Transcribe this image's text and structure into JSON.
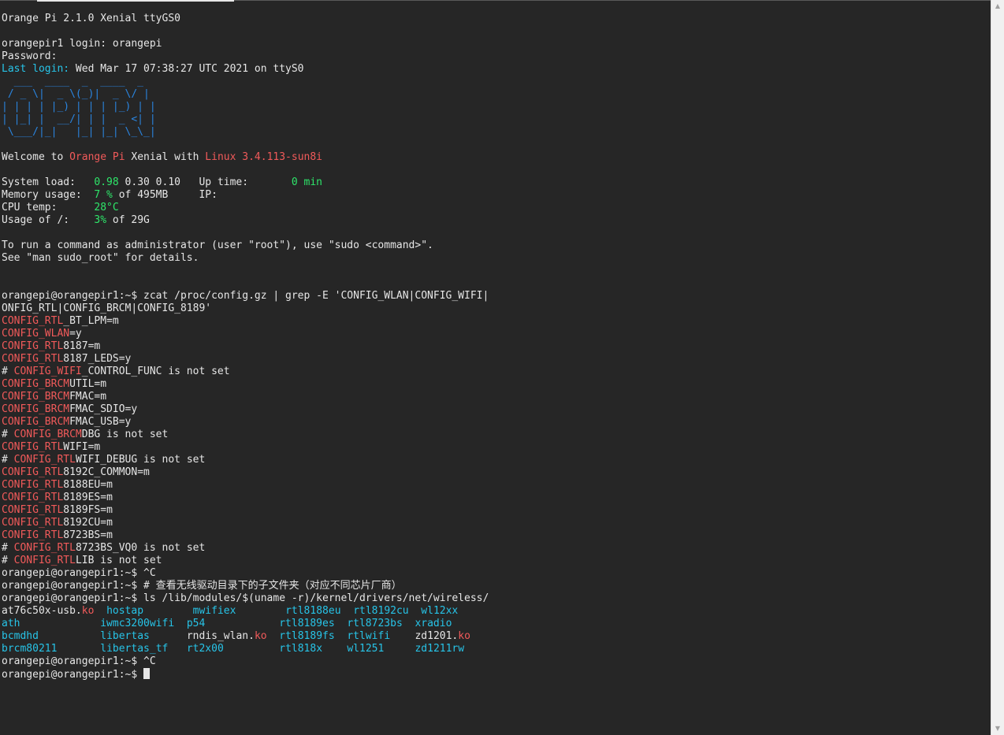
{
  "terminal": {
    "lines": [
      [
        {
          "t": "Orange Pi 2.1.0 Xenial ttyGS0",
          "c": "w"
        }
      ],
      [],
      [
        {
          "t": "orangepir1 login: orangepi",
          "c": "w"
        }
      ],
      [
        {
          "t": "Password:",
          "c": "w"
        }
      ],
      [
        {
          "t": "Last login: ",
          "c": "c"
        },
        {
          "t": "Wed Mar 17 07:38:27 UTC 2021 on ttyS0",
          "c": "w"
        }
      ],
      [
        {
          "t": "  ___  ____  _  ____  _ ",
          "c": "b"
        }
      ],
      [
        {
          "t": " / _ \\|  _ \\(_)|  _ \\/ |",
          "c": "b"
        }
      ],
      [
        {
          "t": "| | | | |_) | | | |_) | |",
          "c": "b"
        }
      ],
      [
        {
          "t": "| |_| |  __/| | |  _ <| |",
          "c": "b"
        }
      ],
      [
        {
          "t": " \\___/|_|   |_| |_| \\_\\_|",
          "c": "b"
        }
      ],
      [],
      [
        {
          "t": "Welcome to ",
          "c": "w"
        },
        {
          "t": "Orange Pi",
          "c": "r"
        },
        {
          "t": " Xenial with ",
          "c": "w"
        },
        {
          "t": "Linux 3.4.113-sun8i",
          "c": "r"
        }
      ],
      [],
      [
        {
          "t": "System load:   ",
          "c": "w"
        },
        {
          "t": "0.98",
          "c": "g"
        },
        {
          "t": " 0.30 0.10   Up time:       ",
          "c": "w"
        },
        {
          "t": "0 min",
          "c": "g"
        }
      ],
      [
        {
          "t": "Memory usage:  ",
          "c": "w"
        },
        {
          "t": "7 %",
          "c": "g"
        },
        {
          "t": " of 495MB     IP:",
          "c": "w"
        }
      ],
      [
        {
          "t": "CPU temp:      ",
          "c": "w"
        },
        {
          "t": "28°C",
          "c": "g"
        }
      ],
      [
        {
          "t": "Usage of /:    ",
          "c": "w"
        },
        {
          "t": "3%",
          "c": "g"
        },
        {
          "t": " of 29G",
          "c": "w"
        }
      ],
      [],
      [
        {
          "t": "To run a command as administrator (user \"root\"), use \"sudo <command>\".",
          "c": "w"
        }
      ],
      [
        {
          "t": "See \"man sudo_root\" for details.",
          "c": "w"
        }
      ],
      [],
      [],
      [
        {
          "t": "orangepi@orangepir1:~$ zcat /proc/config.gz | grep -E 'CONFIG_WLAN|CONFIG_WIFI|",
          "c": "w"
        }
      ],
      [
        {
          "t": "ONFIG_RTL|CONFIG_BRCM|CONFIG_8189'",
          "c": "w"
        }
      ],
      [
        {
          "t": "CONFIG_RTL",
          "c": "r"
        },
        {
          "t": "_BT_LPM=m",
          "c": "w"
        }
      ],
      [
        {
          "t": "CONFIG_WLAN",
          "c": "r"
        },
        {
          "t": "=y",
          "c": "w"
        }
      ],
      [
        {
          "t": "CONFIG_RTL",
          "c": "r"
        },
        {
          "t": "8187=m",
          "c": "w"
        }
      ],
      [
        {
          "t": "CONFIG_RTL",
          "c": "r"
        },
        {
          "t": "8187_LEDS=y",
          "c": "w"
        }
      ],
      [
        {
          "t": "# ",
          "c": "w"
        },
        {
          "t": "CONFIG_WIFI",
          "c": "r"
        },
        {
          "t": "_CONTROL_FUNC is not set",
          "c": "w"
        }
      ],
      [
        {
          "t": "CONFIG_BRCM",
          "c": "r"
        },
        {
          "t": "UTIL=m",
          "c": "w"
        }
      ],
      [
        {
          "t": "CONFIG_BRCM",
          "c": "r"
        },
        {
          "t": "FMAC=m",
          "c": "w"
        }
      ],
      [
        {
          "t": "CONFIG_BRCM",
          "c": "r"
        },
        {
          "t": "FMAC_SDIO=y",
          "c": "w"
        }
      ],
      [
        {
          "t": "CONFIG_BRCM",
          "c": "r"
        },
        {
          "t": "FMAC_USB=y",
          "c": "w"
        }
      ],
      [
        {
          "t": "# ",
          "c": "w"
        },
        {
          "t": "CONFIG_BRCM",
          "c": "r"
        },
        {
          "t": "DBG is not set",
          "c": "w"
        }
      ],
      [
        {
          "t": "CONFIG_RTL",
          "c": "r"
        },
        {
          "t": "WIFI=m",
          "c": "w"
        }
      ],
      [
        {
          "t": "# ",
          "c": "w"
        },
        {
          "t": "CONFIG_RTL",
          "c": "r"
        },
        {
          "t": "WIFI_DEBUG is not set",
          "c": "w"
        }
      ],
      [
        {
          "t": "CONFIG_RTL",
          "c": "r"
        },
        {
          "t": "8192C_COMMON=m",
          "c": "w"
        }
      ],
      [
        {
          "t": "CONFIG_RTL",
          "c": "r"
        },
        {
          "t": "8188EU=m",
          "c": "w"
        }
      ],
      [
        {
          "t": "CONFIG_RTL",
          "c": "r"
        },
        {
          "t": "8189ES=m",
          "c": "w"
        }
      ],
      [
        {
          "t": "CONFIG_RTL",
          "c": "r"
        },
        {
          "t": "8189FS=m",
          "c": "w"
        }
      ],
      [
        {
          "t": "CONFIG_RTL",
          "c": "r"
        },
        {
          "t": "8192CU=m",
          "c": "w"
        }
      ],
      [
        {
          "t": "CONFIG_RTL",
          "c": "r"
        },
        {
          "t": "8723BS=m",
          "c": "w"
        }
      ],
      [
        {
          "t": "# ",
          "c": "w"
        },
        {
          "t": "CONFIG_RTL",
          "c": "r"
        },
        {
          "t": "8723BS_VQ0 is not set",
          "c": "w"
        }
      ],
      [
        {
          "t": "# ",
          "c": "w"
        },
        {
          "t": "CONFIG_RTL",
          "c": "r"
        },
        {
          "t": "LIB is not set",
          "c": "w"
        }
      ],
      [
        {
          "t": "orangepi@orangepir1:~$ ^C",
          "c": "w"
        }
      ],
      [
        {
          "t": "orangepi@orangepir1:~$ # 查看无线驱动目录下的子文件夹（对应不同芯片厂商）",
          "c": "w"
        }
      ],
      [
        {
          "t": "orangepi@orangepir1:~$ ls /lib/modules/$(uname -r)/kernel/drivers/net/wireless/",
          "c": "w"
        }
      ],
      [
        {
          "t": "at76c50x-usb.",
          "c": "w"
        },
        {
          "t": "ko",
          "c": "r"
        },
        {
          "t": "  ",
          "c": "w"
        },
        {
          "t": "hostap",
          "c": "c"
        },
        {
          "t": "        ",
          "c": "w"
        },
        {
          "t": "mwifiex",
          "c": "c"
        },
        {
          "t": "        ",
          "c": "w"
        },
        {
          "t": "rtl8188eu",
          "c": "c"
        },
        {
          "t": "  ",
          "c": "w"
        },
        {
          "t": "rtl8192cu",
          "c": "c"
        },
        {
          "t": "  ",
          "c": "w"
        },
        {
          "t": "wl12xx",
          "c": "c"
        }
      ],
      [
        {
          "t": "ath",
          "c": "c"
        },
        {
          "t": "             ",
          "c": "w"
        },
        {
          "t": "iwmc3200wifi",
          "c": "c"
        },
        {
          "t": "  ",
          "c": "w"
        },
        {
          "t": "p54",
          "c": "c"
        },
        {
          "t": "            ",
          "c": "w"
        },
        {
          "t": "rtl8189es",
          "c": "c"
        },
        {
          "t": "  ",
          "c": "w"
        },
        {
          "t": "rtl8723bs",
          "c": "c"
        },
        {
          "t": "  ",
          "c": "w"
        },
        {
          "t": "xradio",
          "c": "c"
        }
      ],
      [
        {
          "t": "bcmdhd",
          "c": "c"
        },
        {
          "t": "          ",
          "c": "w"
        },
        {
          "t": "libertas",
          "c": "c"
        },
        {
          "t": "      ",
          "c": "w"
        },
        {
          "t": "rndis_wlan.",
          "c": "w"
        },
        {
          "t": "ko",
          "c": "r"
        },
        {
          "t": "  ",
          "c": "w"
        },
        {
          "t": "rtl8189fs",
          "c": "c"
        },
        {
          "t": "  ",
          "c": "w"
        },
        {
          "t": "rtlwifi",
          "c": "c"
        },
        {
          "t": "    ",
          "c": "w"
        },
        {
          "t": "zd1201.",
          "c": "w"
        },
        {
          "t": "ko",
          "c": "r"
        }
      ],
      [
        {
          "t": "brcm80211",
          "c": "c"
        },
        {
          "t": "       ",
          "c": "w"
        },
        {
          "t": "libertas_tf",
          "c": "c"
        },
        {
          "t": "   ",
          "c": "w"
        },
        {
          "t": "rt2x00",
          "c": "c"
        },
        {
          "t": "         ",
          "c": "w"
        },
        {
          "t": "rtl818x",
          "c": "c"
        },
        {
          "t": "    ",
          "c": "w"
        },
        {
          "t": "wl1251",
          "c": "c"
        },
        {
          "t": "     ",
          "c": "w"
        },
        {
          "t": "zd1211rw",
          "c": "c"
        }
      ],
      [
        {
          "t": "orangepi@orangepir1:~$ ^C",
          "c": "w"
        }
      ],
      [
        {
          "t": "orangepi@orangepir1:~$ ",
          "c": "w"
        }
      ]
    ],
    "cursor_line": 52
  },
  "scrollbar": {
    "up_icon": "▲",
    "down_icon": "▼"
  },
  "colors": {
    "background": "#262626",
    "text": "#e6e6e6",
    "cyan": "#27c4e8",
    "red": "#f15a5a",
    "green": "#2ee66a",
    "blue": "#2a85e0"
  }
}
